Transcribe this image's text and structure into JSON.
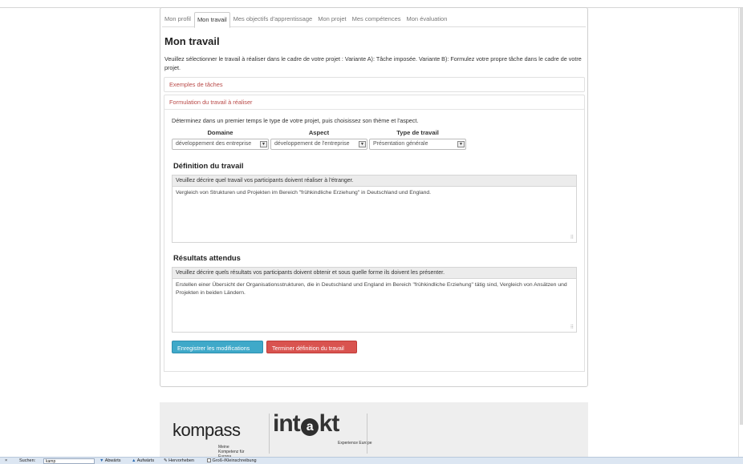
{
  "tabs": [
    {
      "label": "Mon profil"
    },
    {
      "label": "Mon travail"
    },
    {
      "label": "Mes objectifs d'apprentissage"
    },
    {
      "label": "Mon projet"
    },
    {
      "label": "Mes compétences"
    },
    {
      "label": "Mon évaluation"
    }
  ],
  "page": {
    "title": "Mon travail",
    "intro": "Veuillez sélectionner le travail à réaliser dans le cadre de votre projet : Variante A): Tâche imposée. Variante B): Formulez votre propre tâche dans le cadre de votre projet."
  },
  "panels": {
    "examples": "Exemples de tâches",
    "formulation": "Formulation du travail à réaliser"
  },
  "selectors": {
    "lead": "Déterminez dans un premier temps le type de votre projet, puis choisissez son thème et l'aspect.",
    "domaine": {
      "label": "Domaine",
      "value": "développement des entreprise"
    },
    "aspect": {
      "label": "Aspect",
      "value": "développement de l'entreprise"
    },
    "type": {
      "label": "Type de travail",
      "value": "Présentation générale"
    }
  },
  "definition": {
    "title": "Définition du travail",
    "prompt": "Veuillez décrire quel travail vos participants doivent réaliser à l'étranger.",
    "text": "Vergleich von Strukturen und Projekten im Bereich \"frühkindliche Erziehung\" in Deutschland und England."
  },
  "results": {
    "title": "Résultats attendus",
    "prompt": "Veuillez décrire quels résultats vos participants doivent obtenir et sous quelle forme ils doivent les présenter.",
    "text": "Erstellen einer Übersicht der Organisationsstrukturen, die in Deutschland und England im Bereich \"frühkindliche Erziehung\" tätig sind, Vergleich von Ansätzen und Projekten in beiden Ländern."
  },
  "buttons": {
    "save": "Enregistrer les modifications",
    "finish": "Terminer définition du travail"
  },
  "footer": {
    "kompass": "kompass",
    "kompass_sub": "Meine Kompetenz für Europa",
    "intakt_pre": "int",
    "intakt_a": "a",
    "intakt_post": "kt",
    "intakt_sub": "Experience Europe"
  },
  "findbar": {
    "close": "×",
    "label": "Suchen:",
    "value": "kamp",
    "down": "Abwärts",
    "up": "Aufwärts",
    "highlight": "Hervorheben",
    "case": "Groß-/Kleinschreibung"
  },
  "colors": {
    "danger": "#d9534f",
    "info": "#3fa9c9",
    "panel_heading_text": "#b94a48"
  }
}
